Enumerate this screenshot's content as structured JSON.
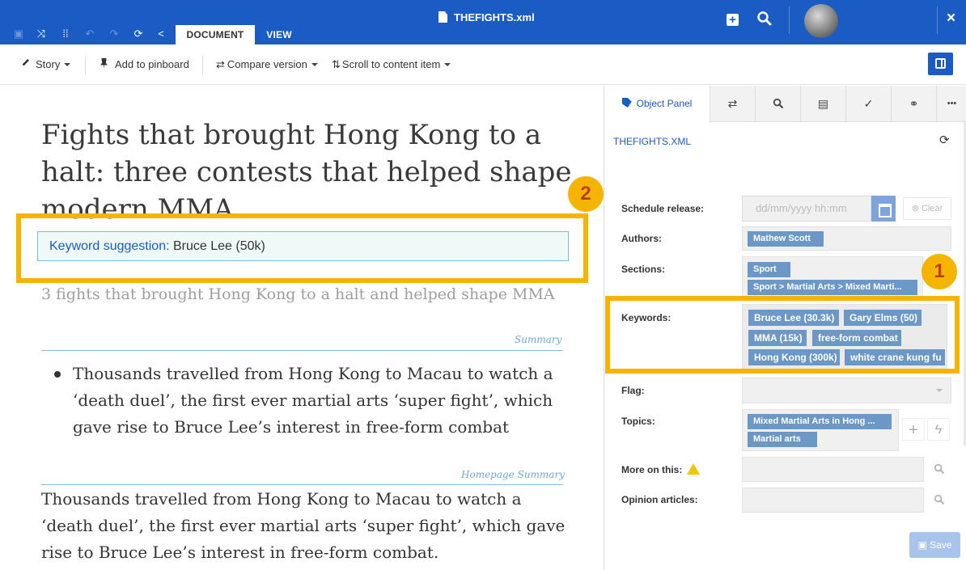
{
  "topbar": {
    "tabs": [
      "DOCUMENT",
      "VIEW"
    ],
    "file_title": "THEFIGHTS.xml",
    "close": "×",
    "accent": "#1b5bc4"
  },
  "toolbar": {
    "story": "Story",
    "pin": "Add to pinboard",
    "compare": "Compare version",
    "scroll": "Scroll to content item"
  },
  "editor": {
    "headline": "Fights that brought Hong Kong to a halt: three contests that helped shape modern MMA",
    "keyword_suggestion_label": "Keyword suggestion:",
    "keyword_suggestion_value": "Bruce Lee (50k)",
    "subheadline": "3 fights that brought Hong Kong to a halt and helped shape MMA",
    "summary_label": "Summary",
    "summary_bullet": "Thousands travelled from Hong Kong to Macau to watch a ‘death duel’, the first ever martial arts ‘super fight’, which gave rise to Bruce Lee’s interest in free-form combat",
    "homepage_summary_label": "Homepage Summary",
    "homepage_summary": "Thousands travelled from Hong Kong to Macau to watch a ‘death duel’, the first ever martial arts ‘super fight’, which gave rise to Bruce Lee’s interest in free-form combat."
  },
  "panel": {
    "tabs": {
      "object_panel": "Object Panel",
      "more": "•••"
    },
    "file_name": "THEFIGHTS.XML",
    "schedule_label": "Schedule release:",
    "schedule_placeholder": "dd/mm/yyyy hh:mm",
    "clear_label": "Clear",
    "authors_label": "Authors:",
    "authors": [
      "Mathew Scott"
    ],
    "sections_label": "Sections:",
    "sections": [
      "Sport",
      "Sport > Martial Arts > Mixed Marti..."
    ],
    "keywords_label": "Keywords:",
    "keywords": [
      "Bruce Lee (30.3k)",
      "Gary Elms (50)",
      "MMA (15k)",
      "free-form combat",
      "Hong Kong (300k)",
      "white crane kung fu"
    ],
    "flag_label": "Flag:",
    "topics_label": "Topics:",
    "topics": [
      "Mixed Martial Arts in Hong ...",
      "Martial arts"
    ],
    "more_label": "More on this:",
    "opinion_label": "Opinion articles:",
    "save_label": "Save",
    "plus": "+"
  },
  "annotations": {
    "badge1": "1",
    "badge2": "2",
    "highlight_color": "#f5b400"
  }
}
